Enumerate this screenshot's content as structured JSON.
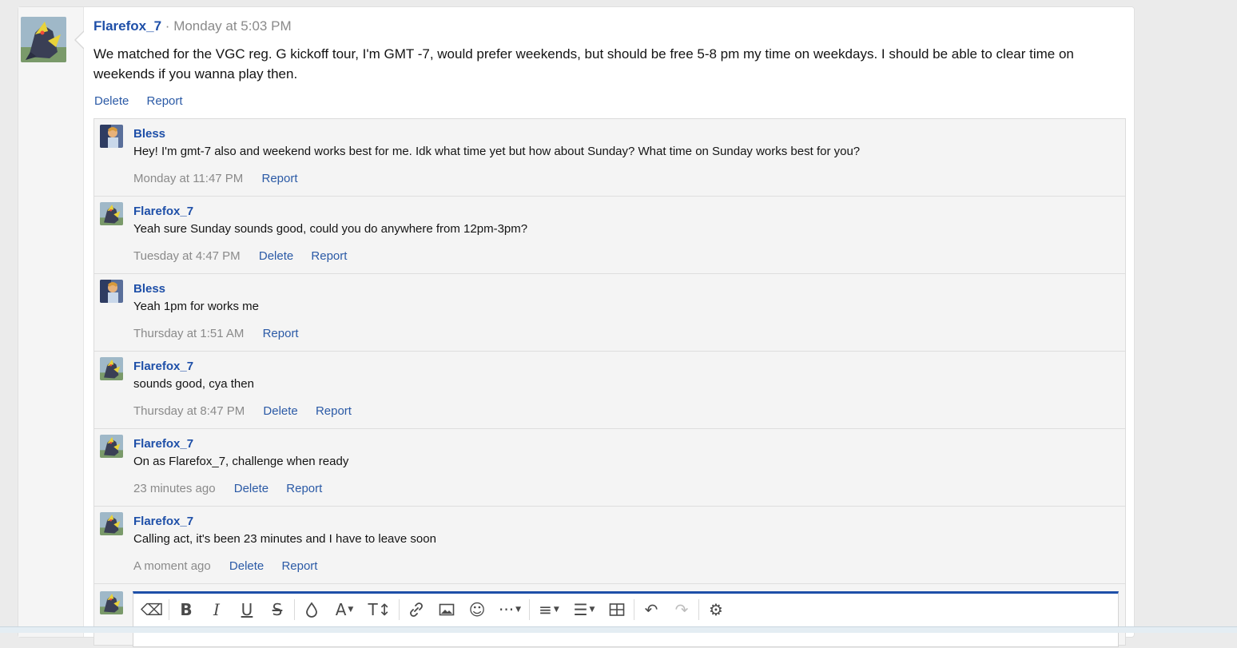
{
  "post": {
    "username": "Flarefox_7",
    "separator": "·",
    "time": "Monday at 5:03 PM",
    "body": "We matched for the VGC reg. G kickoff tour, I'm GMT -7, would prefer weekends, but should be free 5-8 pm my time on weekdays. I should be able to clear time on weekends if you wanna play then.",
    "actions": {
      "delete": "Delete",
      "report": "Report"
    }
  },
  "comments": [
    {
      "username": "Bless",
      "text": "Hey! I'm gmt-7 also and weekend works best for me. Idk what time yet but how about Sunday? What time on Sunday works best for you?",
      "time": "Monday at 11:47 PM",
      "report": "Report"
    },
    {
      "username": "Flarefox_7",
      "text": "Yeah sure Sunday sounds good, could you do anywhere from 12pm-3pm?",
      "time": "Tuesday at 4:47 PM",
      "delete": "Delete",
      "report": "Report"
    },
    {
      "username": "Bless",
      "text": "Yeah 1pm for works me",
      "time": "Thursday at 1:51 AM",
      "report": "Report"
    },
    {
      "username": "Flarefox_7",
      "text": "sounds good, cya then",
      "time": "Thursday at 8:47 PM",
      "delete": "Delete",
      "report": "Report"
    },
    {
      "username": "Flarefox_7",
      "text": "On as Flarefox_7, challenge when ready",
      "time": "23 minutes ago",
      "delete": "Delete",
      "report": "Report"
    },
    {
      "username": "Flarefox_7",
      "text": "Calling act, it's been 23 minutes and I have to leave soon",
      "time": "A moment ago",
      "delete": "Delete",
      "report": "Report"
    }
  ],
  "toolbar": {
    "clear": "⌫",
    "bold": "B",
    "italic": "I",
    "underline": "U",
    "strike": "S",
    "color": "💧",
    "font": "A",
    "size": "T↕",
    "link": "🔗",
    "image": "▣",
    "smilie": "☺",
    "more": "···",
    "align": "≡",
    "list": "☰",
    "table": "⊞",
    "undo": "↶",
    "redo": "↷",
    "settings": "⚙"
  },
  "colors": {
    "link": "#2b5aa6",
    "username": "#1e4fa8",
    "meta": "#8a8a8a",
    "editor_accent": "#1e4fa8"
  }
}
